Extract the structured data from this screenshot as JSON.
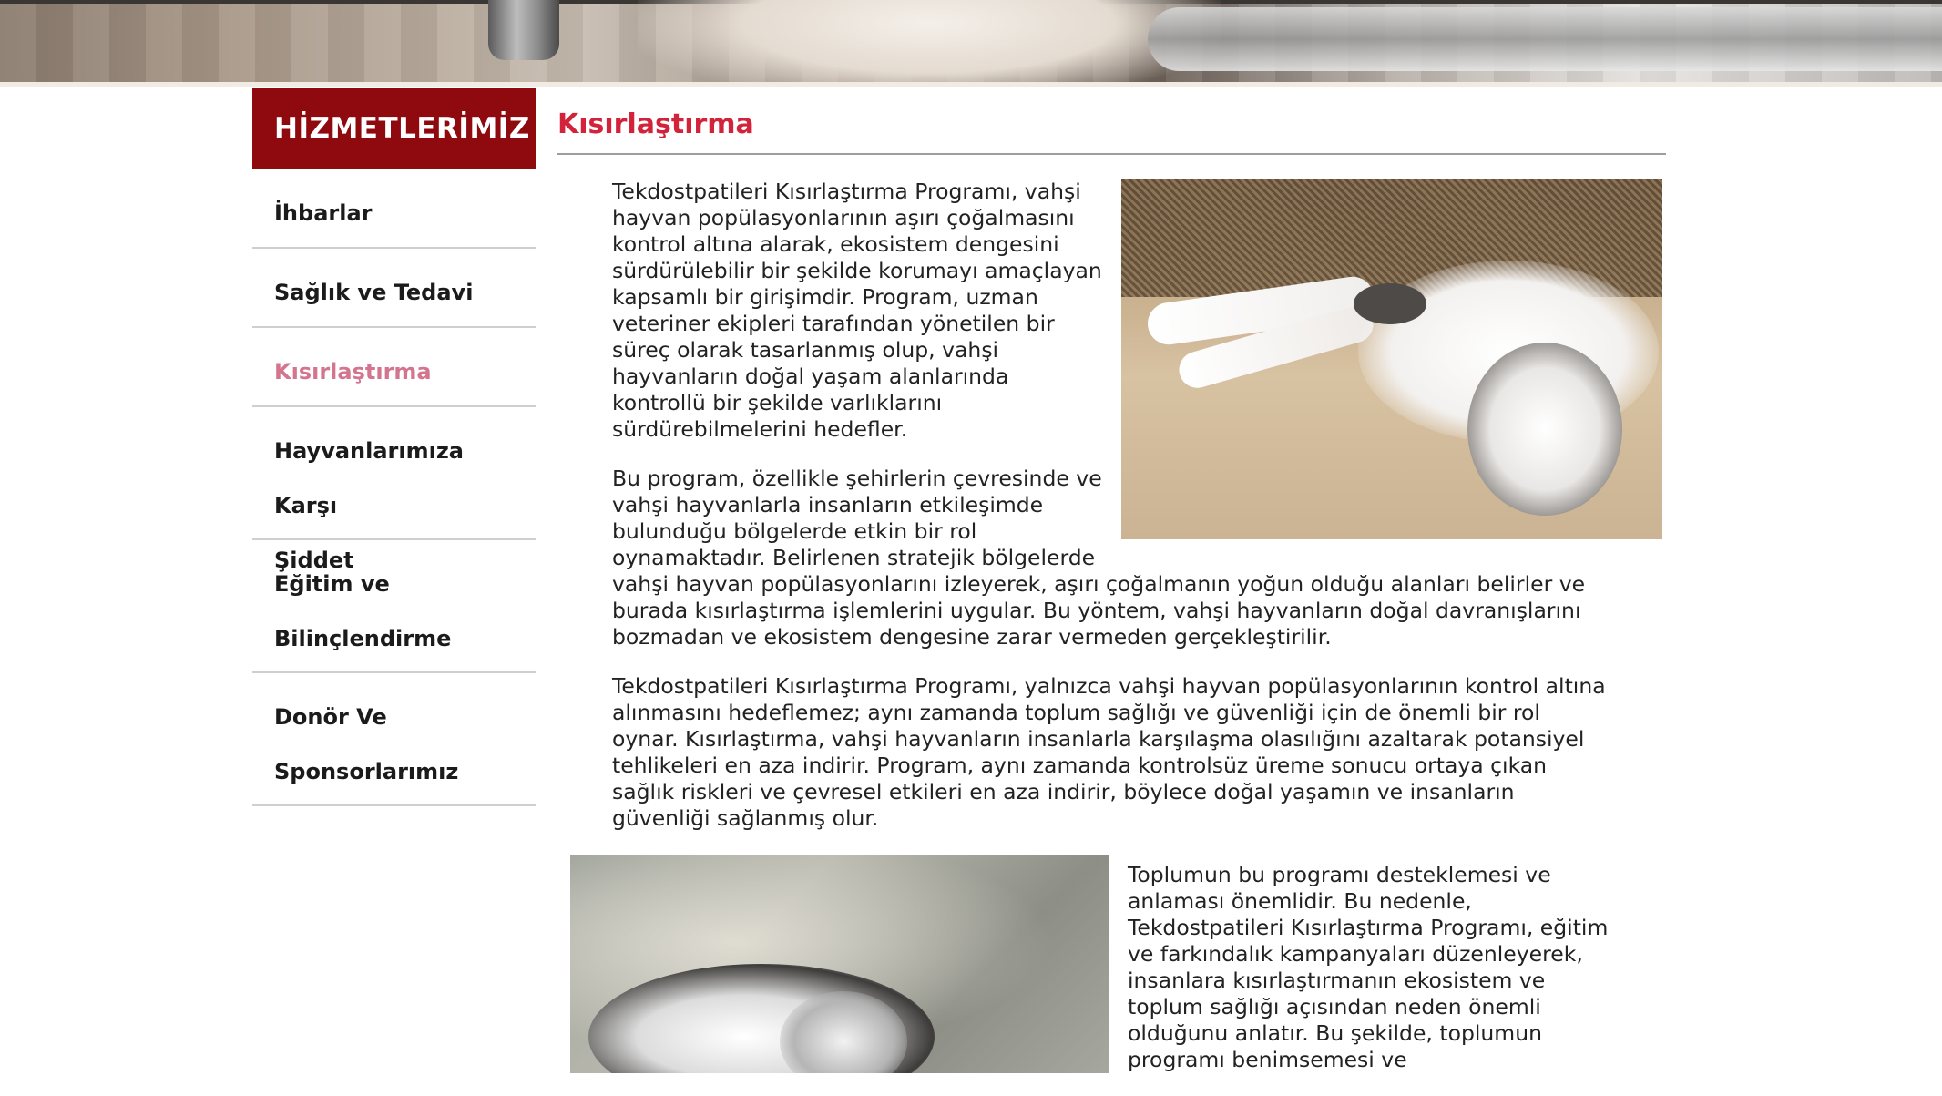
{
  "hero": {
    "description_icon": "banner-image"
  },
  "sidebar": {
    "title": "HİZMETLERİMİZ",
    "items": [
      {
        "line1": "İhbarlar",
        "line2": "",
        "active": false
      },
      {
        "line1": "Sağlık ve Tedavi",
        "line2": "",
        "active": false
      },
      {
        "line1": "Kısırlaştırma",
        "line2": "",
        "active": true
      },
      {
        "line1": "Hayvanlarımıza Karşı",
        "line2": "Şiddet",
        "active": false
      },
      {
        "line1": "Eğitim ve",
        "line2": "Bilinçlendirme",
        "active": false
      },
      {
        "line1": "Donör Ve",
        "line2": "Sponsorlarımız",
        "active": false
      }
    ]
  },
  "main": {
    "title": "Kısırlaştırma",
    "paragraphs": [
      "Tekdostpatileri Kısırlaştırma Programı, vahşi hayvan popülasyonlarının aşırı çoğalmasını kontrol altına alarak, ekosistem dengesini sürdürülebilir bir şekilde korumayı amaçlayan kapsamlı bir girişimdir. Program, uzman veteriner ekipleri tarafından yönetilen bir süreç olarak tasarlanmış olup, vahşi hayvanların doğal yaşam alanlarında kontrollü bir şekilde varlıklarını sürdürebilmelerini hedefler.",
      "Bu program, özellikle şehirlerin çevresinde ve vahşi hayvanlarla insanların etkileşimde bulunduğu bölgelerde etkin bir rol oynamaktadır. Belirlenen stratejik bölgelerde vahşi hayvan popülasyonlarını izleyerek, aşırı çoğalmanın yoğun olduğu alanları belirler ve burada kısırlaştırma işlemlerini uygular. Bu yöntem, vahşi hayvanların doğal davranışlarını bozmadan ve ekosistem dengesine zarar vermeden gerçekleştirilir.",
      "Tekdostpatileri Kısırlaştırma Programı, yalnızca vahşi hayvan popülasyonlarının kontrol altına alınmasını hedeflemez; aynı zamanda toplum sağlığı ve güvenliği için de önemli bir rol oynar. Kısırlaştırma, vahşi hayvanların insanlarla karşılaşma olasılığını azaltarak potansiyel tehlikeleri en aza indirir. Program, aynı zamanda kontrolsüz üreme sonucu ortaya çıkan sağlık riskleri ve çevresel etkileri en aza indirir, böylece doğal yaşamın ve insanların güvenliği sağlanmış olur.",
      "Toplumun bu programı desteklemesi ve anlaması önemlidir. Bu nedenle, Tekdostpatileri Kısırlaştırma Programı, eğitim ve farkındalık kampanyaları düzenleyerek, insanlara kısırlaştırmanın ekosistem ve toplum sağlığı açısından neden önemli olduğunu anlatır. Bu şekilde, toplumun programı benimsemesi ve"
    ],
    "images": [
      {
        "icon": "cat-photo"
      },
      {
        "icon": "kitten-photo"
      }
    ]
  },
  "colors": {
    "sidebar_title_bg": "#8e0a0f",
    "title_red": "#d2233a",
    "active_pink": "#d4758f"
  }
}
